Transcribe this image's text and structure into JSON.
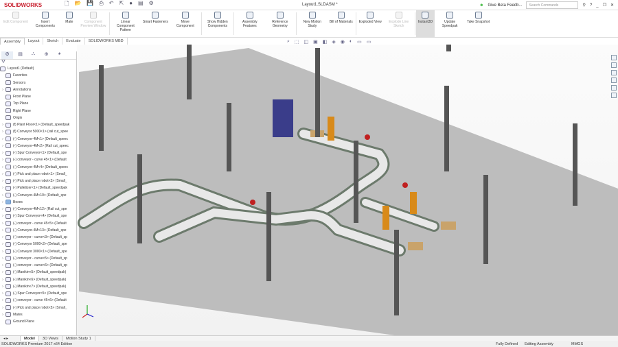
{
  "app": {
    "logo": "SOLIDWORKS",
    "doc_title": "Layout1.SLDASM *",
    "feedback": "Give Beta Feedb...",
    "search_placeholder": "Search Commands",
    "help": "?"
  },
  "ribbon": [
    {
      "label": "Edit Component",
      "disabled": true
    },
    {
      "label": "Insert Components"
    },
    {
      "label": "Mate"
    },
    {
      "label": "Component Preview Window",
      "disabled": true
    },
    {
      "label": "Linear Component Pattern"
    },
    {
      "label": "Smart Fasteners"
    },
    {
      "label": "Move Component"
    },
    {
      "label": "Show Hidden Components"
    },
    {
      "label": "Assembly Features"
    },
    {
      "label": "Reference Geometry"
    },
    {
      "label": "New Motion Study"
    },
    {
      "label": "Bill of Materials"
    },
    {
      "label": "Exploded View"
    },
    {
      "label": "Explode Line Sketch",
      "disabled": true
    },
    {
      "label": "Instant3D",
      "active": true
    },
    {
      "label": "Update Speedpak"
    },
    {
      "label": "Take Snapshot"
    }
  ],
  "command_tabs": [
    "Assembly",
    "Layout",
    "Sketch",
    "Evaluate",
    "SOLIDWORKS MBD"
  ],
  "tree": {
    "root": "Layout1  (Default)",
    "items": [
      {
        "label": "Favorites",
        "type": "folder"
      },
      {
        "label": "Sensors",
        "type": "folder"
      },
      {
        "label": "Annotations",
        "type": "folder",
        "exp": true
      },
      {
        "label": "Front Plane",
        "type": "plane"
      },
      {
        "label": "Top Plane",
        "type": "plane"
      },
      {
        "label": "Right Plane",
        "type": "plane"
      },
      {
        "label": "Origin",
        "type": "origin"
      },
      {
        "label": "(f) Plant Floor<1> (Default_speedpak",
        "exp": true
      },
      {
        "label": "(f) Conveyor 5000<1> (rail cut_spee",
        "exp": true
      },
      {
        "label": "(-) Conveyor-4M<1> (Default_speec",
        "exp": true
      },
      {
        "label": "(-) Conveyor-4M<2> (Rail cut_speec",
        "exp": true
      },
      {
        "label": "(-) Spur Conveyor<1> (Default_spe",
        "exp": true
      },
      {
        "label": "(-) conveyor - curve 45<1> (Default",
        "exp": true
      },
      {
        "label": "(-) Conveyor-4M<4> (Default_speec",
        "exp": true
      },
      {
        "label": "(-) Pick and place robot<1> (Small_",
        "exp": true
      },
      {
        "label": "(-) Pick and place robot<3> (Small_",
        "exp": true
      },
      {
        "label": "(-) Palletizer<1> (Default_speedpak",
        "exp": true
      },
      {
        "label": "(-) Conveyor-4M<10> (Default_spe",
        "exp": true
      },
      {
        "label": "Boxes",
        "type": "bluefolder",
        "exp": true
      },
      {
        "label": "(-) Conveyor-4M<12> (Rail cut_spe",
        "exp": true
      },
      {
        "label": "(-) Spur Conveyor<4> (Default_spe",
        "exp": true
      },
      {
        "label": "(-) conveyor - curve 45<5> (Default",
        "exp": true
      },
      {
        "label": "(-) Conveyor-4M<13> (Default_spe",
        "exp": true
      },
      {
        "label": "(-) conveyor - curve<3> (Default_sp",
        "exp": true
      },
      {
        "label": "(-) Conveyor 5000<2> (Default_spe",
        "exp": true
      },
      {
        "label": "(-) Conveyor 3000<1> (Default_spe",
        "exp": true
      },
      {
        "label": "(-) conveyor - curve<5> (Default_sp",
        "exp": true
      },
      {
        "label": "(-) conveyor - curve<6> (Default_sp",
        "exp": true
      },
      {
        "label": "(-) Manikin<5> (Default_speedpak)",
        "exp": true
      },
      {
        "label": "(-) Manikin<6> (Default_speedpak)",
        "exp": true
      },
      {
        "label": "(-) Manikin<7> (Default_speedpak)",
        "exp": true
      },
      {
        "label": "(-) Spur Conveyor<5> (Default_spe",
        "exp": true
      },
      {
        "label": "(-) conveyor - curve 45<6> (Default",
        "exp": true
      },
      {
        "label": "(-) Pick and place robot<5> (Small_",
        "exp": true
      },
      {
        "label": "Mates",
        "type": "folder",
        "exp": true
      },
      {
        "label": "Ground Plane",
        "type": "plane"
      }
    ]
  },
  "bottom_tabs": [
    "Model",
    "3D Views",
    "Motion Study 1"
  ],
  "status": {
    "edition": "SOLIDWORKS Premium 2017 x64 Edition",
    "state": "Fully Defined",
    "mode": "Editing Assembly",
    "units": "MMGS"
  }
}
